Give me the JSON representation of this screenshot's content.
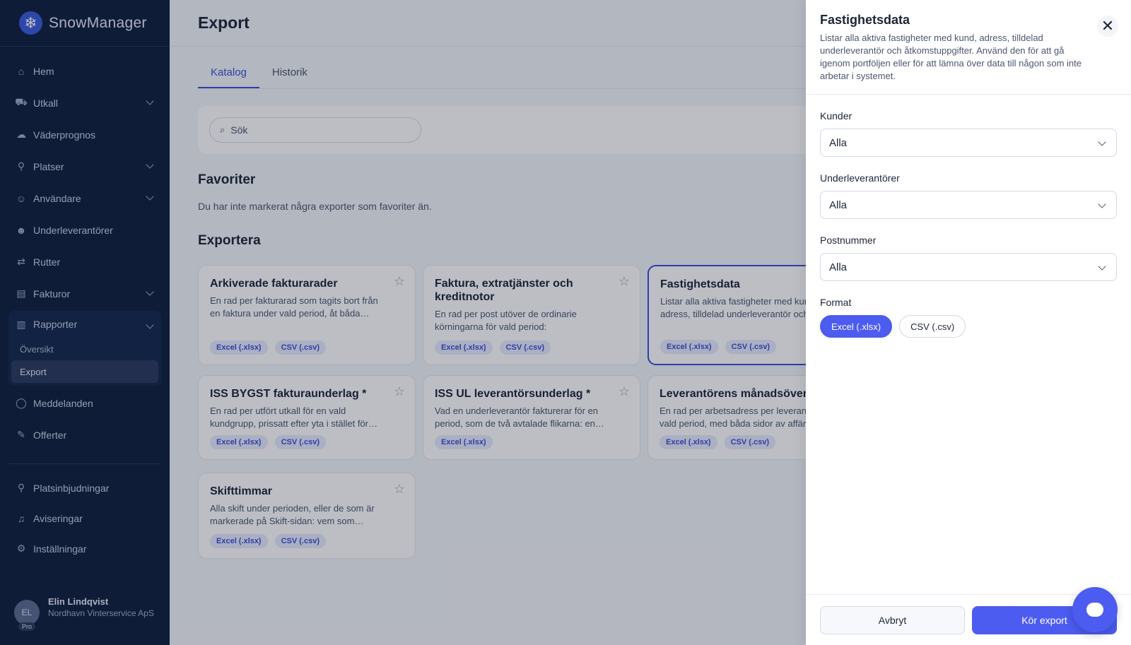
{
  "brand": {
    "name": "SnowManager",
    "logo_icon": "snowflake-icon"
  },
  "sidebar": {
    "items": [
      {
        "label": "Hem",
        "icon": "home-icon"
      },
      {
        "label": "Utkall",
        "icon": "truck-icon",
        "expandable": true
      },
      {
        "label": "Väderprognos",
        "icon": "cloud-icon"
      },
      {
        "label": "Platser",
        "icon": "map-pin-icon",
        "expandable": true
      },
      {
        "label": "Användare",
        "icon": "user-icon",
        "expandable": true
      },
      {
        "label": "Underleverantörer",
        "icon": "users-icon"
      },
      {
        "label": "Rutter",
        "icon": "route-icon"
      },
      {
        "label": "Fakturor",
        "icon": "invoice-icon",
        "expandable": true
      }
    ],
    "group": {
      "label": "Rapporter",
      "icon": "chart-icon",
      "sub_items": [
        {
          "label": "Översikt"
        },
        {
          "label": "Export",
          "active": true
        }
      ]
    },
    "items_after": [
      {
        "label": "Meddelanden",
        "icon": "message-icon"
      },
      {
        "label": "Offerter",
        "icon": "offer-icon"
      }
    ],
    "bottom_items": [
      {
        "label": "Platsinbjudningar",
        "icon": "invite-icon"
      },
      {
        "label": "Aviseringar",
        "icon": "bell-icon"
      },
      {
        "label": "Inställningar",
        "icon": "gear-icon"
      }
    ],
    "user": {
      "initials": "EL",
      "badge": "Pro",
      "name": "Elin Lindqvist",
      "org": "Nordhavn Vinterservice ApS"
    }
  },
  "main": {
    "title": "Export",
    "tabs": [
      {
        "label": "Katalog",
        "active": true
      },
      {
        "label": "Historik"
      }
    ],
    "search": {
      "placeholder": "Sök"
    },
    "favorites": {
      "title": "Favoriter",
      "empty": "Du har inte markerat några exporter som favoriter än."
    },
    "exports": {
      "title": "Exportera",
      "cards": [
        {
          "title": "Arkiverade fakturarader",
          "desc": "En rad per fakturarad som tagits bort från en faktura under vald period, åt båda…",
          "badges": [
            "Excel (.xlsx)",
            "CSV (.csv)"
          ]
        },
        {
          "title": "Faktura, extratjänster och kreditnotor",
          "desc": "En rad per post utöver de ordinarie körningarna för vald period: extratjänster,…",
          "badges": [
            "Excel (.xlsx)",
            "CSV (.csv)"
          ]
        },
        {
          "title": "Fastighetsdata",
          "desc": "Listar alla aktiva fastigheter med kund, adress, tilldelad underleverantör och…",
          "badges": [
            "Excel (.xlsx)",
            "CSV (.csv)"
          ],
          "selected": true
        },
        {
          "title": "ISS BYGST fakturaunderlag *",
          "desc": "En rad per utfört utkall för en vald kundgrupp, prissatt efter yta i stället för…",
          "badges": [
            "Excel (.xlsx)",
            "CSV (.csv)"
          ]
        },
        {
          "title": "ISS UL leverantörsunderlag *",
          "desc": "Vad en underleverantör fakturerar för en period, som de två avtalade flikarna: en…",
          "badges": [
            "Excel (.xlsx)"
          ]
        },
        {
          "title": "Leverantörens månadsöversikt",
          "desc": "En rad per arbetsadress per leverantör för vald period, med båda sidor av affären…",
          "badges": [
            "Excel (.xlsx)",
            "CSV (.csv)"
          ]
        },
        {
          "title": "Skifttimmar",
          "desc": "Alla skift under perioden, eller de som är markerade på Skift-sidan: vem som…",
          "badges": [
            "Excel (.xlsx)",
            "CSV (.csv)"
          ]
        }
      ]
    }
  },
  "drawer": {
    "title": "Fastighetsdata",
    "description": "Listar alla aktiva fastigheter med kund, adress, tilldelad underleverantör och åtkomstuppgifter. Använd den för att gå igenom portföljen eller för att lämna över data till någon som inte arbetar i systemet.",
    "fields": [
      {
        "label": "Kunder",
        "value": "Alla"
      },
      {
        "label": "Underleverantörer",
        "value": "Alla"
      },
      {
        "label": "Postnummer",
        "value": "Alla"
      }
    ],
    "format": {
      "label": "Format",
      "options": [
        "Excel (.xlsx)",
        "CSV (.csv)"
      ],
      "selected": "Excel (.xlsx)"
    },
    "cancel_label": "Avbryt",
    "run_label": "Kör export"
  },
  "colors": {
    "sidebar": "#0f1f3d",
    "accent": "#4c5cf0",
    "selected_border": "#3b4fd8"
  }
}
